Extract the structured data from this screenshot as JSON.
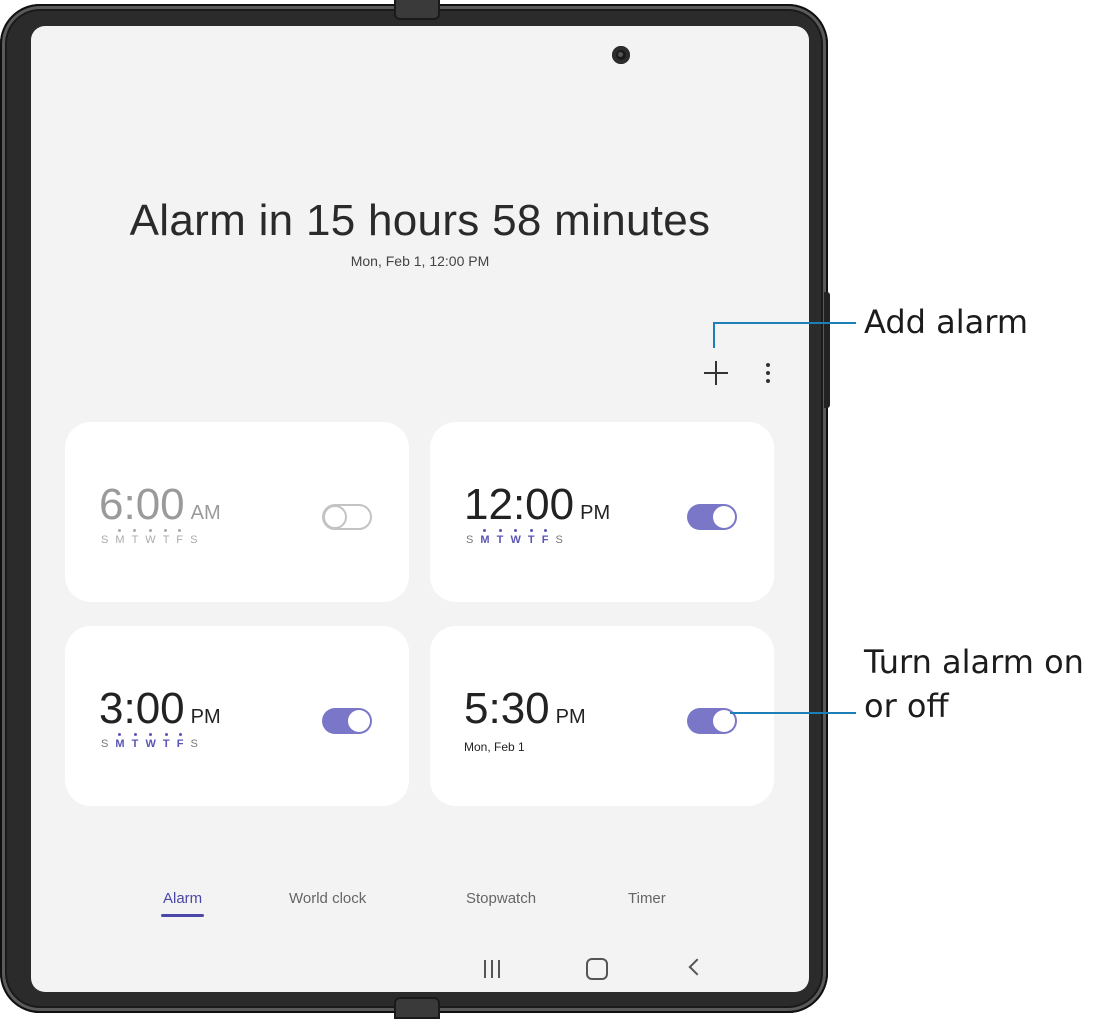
{
  "header": {
    "headline": "Alarm in 15 hours 58 minutes",
    "subline": "Mon, Feb 1, 12:00 PM"
  },
  "toolbar": {
    "add_icon": "plus-icon",
    "more_icon": "more-options-icon"
  },
  "alarms": [
    {
      "time": "6:00",
      "ampm": "AM",
      "days": [
        "S",
        "M",
        "T",
        "W",
        "T",
        "F",
        "S"
      ],
      "active_days": [
        false,
        true,
        true,
        true,
        true,
        true,
        false
      ],
      "enabled": false
    },
    {
      "time": "12:00",
      "ampm": "PM",
      "days": [
        "S",
        "M",
        "T",
        "W",
        "T",
        "F",
        "S"
      ],
      "active_days": [
        false,
        true,
        true,
        true,
        true,
        true,
        false
      ],
      "enabled": true
    },
    {
      "time": "3:00",
      "ampm": "PM",
      "days": [
        "S",
        "M",
        "T",
        "W",
        "T",
        "F",
        "S"
      ],
      "active_days": [
        false,
        true,
        true,
        true,
        true,
        true,
        false
      ],
      "enabled": true
    },
    {
      "time": "5:30",
      "ampm": "PM",
      "date": "Mon, Feb 1",
      "enabled": true
    }
  ],
  "tabs": [
    {
      "label": "Alarm",
      "active": true
    },
    {
      "label": "World clock",
      "active": false
    },
    {
      "label": "Stopwatch",
      "active": false
    },
    {
      "label": "Timer",
      "active": false
    }
  ],
  "navbar": {
    "recents_icon": "recents-icon",
    "home_icon": "home-icon",
    "back_icon": "back-icon"
  },
  "callouts": {
    "add_alarm": "Add alarm",
    "toggle_line1": "Turn alarm on",
    "toggle_line2": "or off"
  },
  "colors": {
    "accent": "#4b47a8",
    "toggle_on": "#7a77c9",
    "callout_line": "#1d7fb8"
  }
}
